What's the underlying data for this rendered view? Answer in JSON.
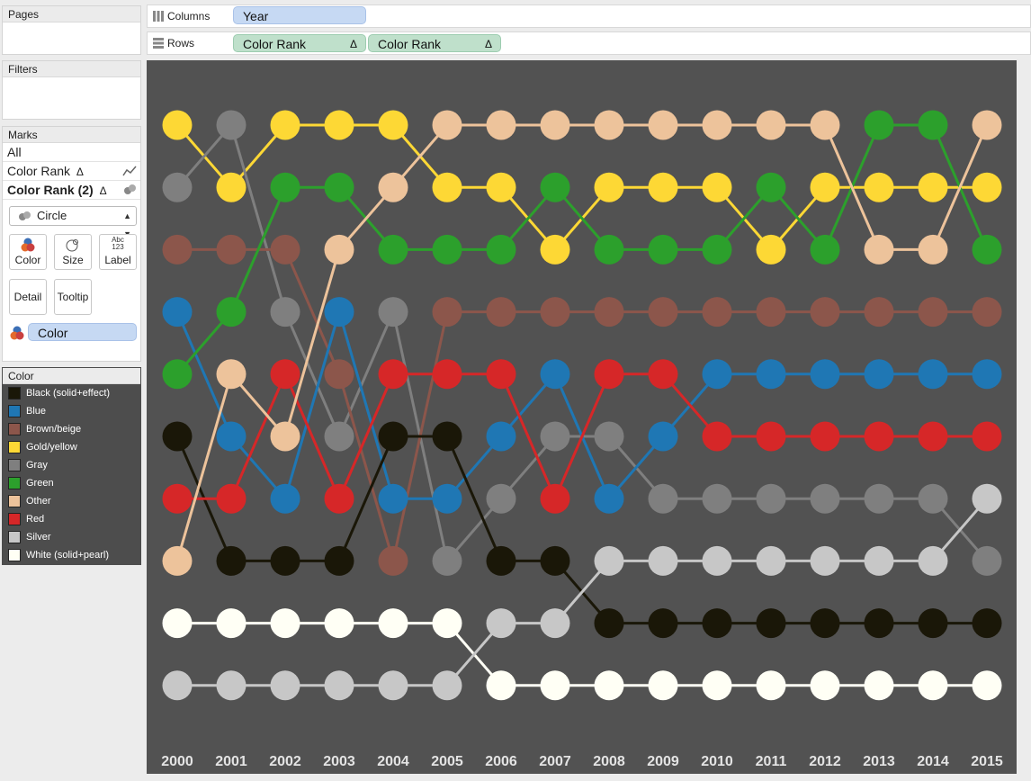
{
  "shelves": {
    "pages_title": "Pages",
    "filters_title": "Filters",
    "columns_label": "Columns",
    "rows_label": "Rows",
    "columns_pill": "Year",
    "rows_pills": [
      "Color Rank",
      "Color Rank"
    ],
    "delta": "Δ"
  },
  "marks": {
    "title": "Marks",
    "all": "All",
    "layer1": "Color Rank",
    "layer2": "Color Rank (2)",
    "delta": "Δ",
    "mark_type": "Circle",
    "buttons": {
      "color": "Color",
      "size": "Size",
      "label": "Label",
      "detail": "Detail",
      "tooltip": "Tooltip",
      "abc": "Abc",
      "num": "123"
    },
    "color_field": "Color"
  },
  "legend": {
    "title": "Color",
    "items": [
      {
        "label": "Black (solid+effect)",
        "color": "#1a1708"
      },
      {
        "label": "Blue",
        "color": "#1f77b4"
      },
      {
        "label": "Brown/beige",
        "color": "#8c564b"
      },
      {
        "label": "Gold/yellow",
        "color": "#fdd835"
      },
      {
        "label": "Gray",
        "color": "#7f7f7f"
      },
      {
        "label": "Green",
        "color": "#2ca02c"
      },
      {
        "label": "Other",
        "color": "#edc39b"
      },
      {
        "label": "Red",
        "color": "#d62728"
      },
      {
        "label": "Silver",
        "color": "#c7c7c7"
      },
      {
        "label": "White (solid+pearl)",
        "color": "#fffff5"
      }
    ]
  },
  "chart_data": {
    "type": "line",
    "x": [
      "2000",
      "2001",
      "2002",
      "2003",
      "2004",
      "2005",
      "2006",
      "2007",
      "2008",
      "2009",
      "2010",
      "2011",
      "2012",
      "2013",
      "2014",
      "2015"
    ],
    "yrange": [
      1,
      10
    ],
    "y_reversed": true,
    "series": [
      {
        "name": "Gold/yellow",
        "color": "#fdd835",
        "values": [
          1,
          2,
          1,
          1,
          1,
          2,
          2,
          3,
          2,
          2,
          2,
          3,
          2,
          2,
          2,
          2
        ]
      },
      {
        "name": "Gray",
        "color": "#7f7f7f",
        "values": [
          2,
          1,
          4,
          6,
          4,
          8,
          7,
          6,
          6,
          7,
          7,
          7,
          7,
          7,
          7,
          8
        ]
      },
      {
        "name": "Brown/beige",
        "color": "#8c564b",
        "values": [
          3,
          3,
          3,
          5,
          8,
          4,
          4,
          4,
          4,
          4,
          4,
          4,
          4,
          4,
          4,
          4
        ]
      },
      {
        "name": "Blue",
        "color": "#1f77b4",
        "values": [
          4,
          6,
          7,
          4,
          7,
          7,
          6,
          5,
          7,
          6,
          5,
          5,
          5,
          5,
          5,
          5
        ]
      },
      {
        "name": "Green",
        "color": "#2ca02c",
        "values": [
          5,
          4,
          2,
          2,
          3,
          3,
          3,
          2,
          3,
          3,
          3,
          2,
          3,
          1,
          1,
          3
        ]
      },
      {
        "name": "Black (solid+effect)",
        "color": "#1a1708",
        "values": [
          6,
          8,
          8,
          8,
          6,
          6,
          8,
          8,
          9,
          9,
          9,
          9,
          9,
          9,
          9,
          9
        ]
      },
      {
        "name": "Red",
        "color": "#d62728",
        "values": [
          7,
          7,
          5,
          7,
          5,
          5,
          5,
          7,
          5,
          5,
          6,
          6,
          6,
          6,
          6,
          6
        ]
      },
      {
        "name": "Other",
        "color": "#edc39b",
        "values": [
          8,
          5,
          6,
          3,
          2,
          1,
          1,
          1,
          1,
          1,
          1,
          1,
          1,
          3,
          3,
          1
        ]
      },
      {
        "name": "White (solid+pearl)",
        "color": "#fffff5",
        "values": [
          9,
          9,
          9,
          9,
          9,
          9,
          10,
          10,
          10,
          10,
          10,
          10,
          10,
          10,
          10,
          10
        ]
      },
      {
        "name": "Silver",
        "color": "#c7c7c7",
        "values": [
          10,
          10,
          10,
          10,
          10,
          10,
          9,
          9,
          8,
          8,
          8,
          8,
          8,
          8,
          8,
          7
        ]
      }
    ]
  }
}
